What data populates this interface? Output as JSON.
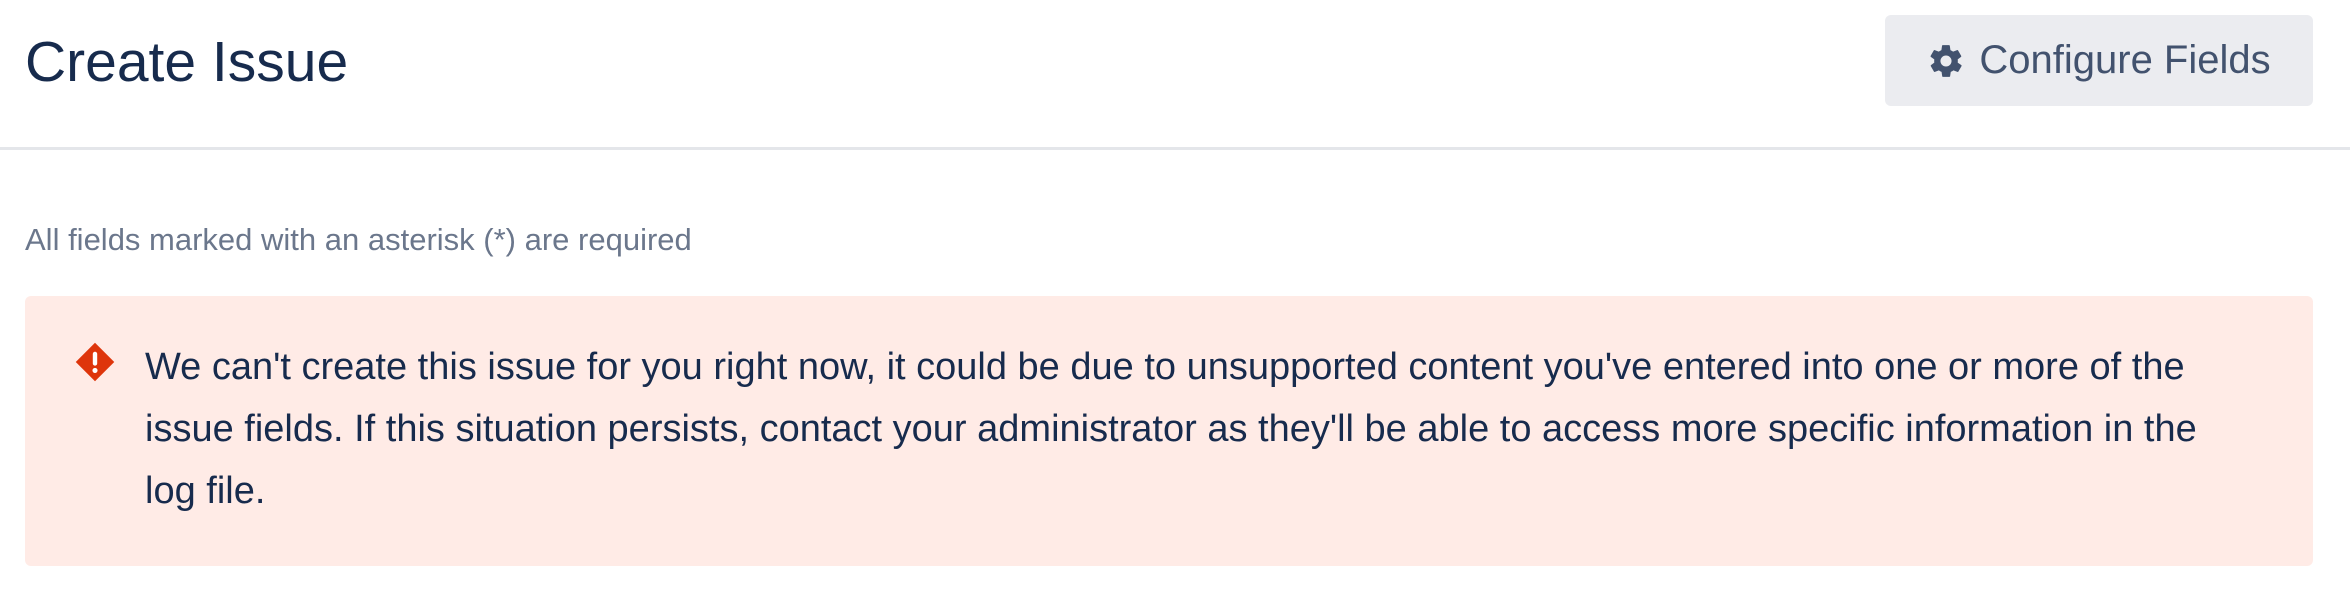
{
  "header": {
    "title": "Create Issue",
    "configure_button": {
      "label": "Configure Fields",
      "icon": "gear-icon"
    }
  },
  "form": {
    "required_note": "All fields marked with an asterisk (*) are required"
  },
  "error": {
    "icon": "error-icon",
    "message": "We can't create this issue for you right now, it could be due to unsupported content you've entered into one or more of the issue fields. If this situation persists, contact your administrator as they'll be able to access more specific information in the log file."
  },
  "colors": {
    "title_text": "#172b4d",
    "button_bg": "#ebecf0",
    "error_bg": "#ffebe6",
    "error_icon": "#de350b",
    "muted_text": "#6b778c"
  }
}
